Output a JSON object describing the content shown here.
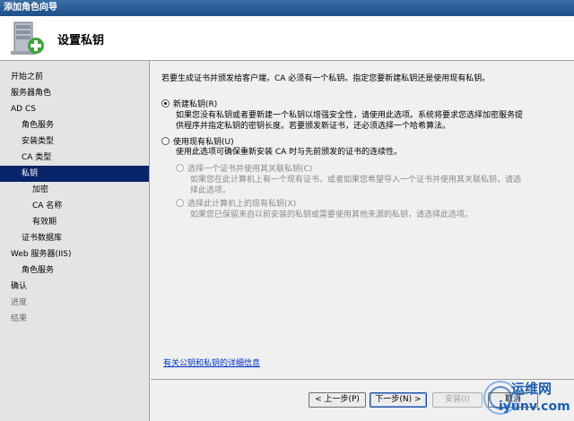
{
  "window": {
    "title": "添加角色向导"
  },
  "header": {
    "page_title": "设置私钥"
  },
  "sidebar": {
    "items": [
      {
        "label": "开始之前",
        "level": 0,
        "state": "normal"
      },
      {
        "label": "服务器角色",
        "level": 0,
        "state": "normal"
      },
      {
        "label": "AD CS",
        "level": 0,
        "state": "normal"
      },
      {
        "label": "角色服务",
        "level": 1,
        "state": "normal"
      },
      {
        "label": "安装类型",
        "level": 1,
        "state": "normal"
      },
      {
        "label": "CA 类型",
        "level": 1,
        "state": "normal"
      },
      {
        "label": "私钥",
        "level": 1,
        "state": "active"
      },
      {
        "label": "加密",
        "level": 2,
        "state": "normal"
      },
      {
        "label": "CA 名称",
        "level": 2,
        "state": "normal"
      },
      {
        "label": "有效期",
        "level": 2,
        "state": "normal"
      },
      {
        "label": "证书数据库",
        "level": 1,
        "state": "normal"
      },
      {
        "label": "Web 服务器(IIS)",
        "level": 0,
        "state": "normal"
      },
      {
        "label": "角色服务",
        "level": 1,
        "state": "normal"
      },
      {
        "label": "确认",
        "level": 0,
        "state": "normal"
      },
      {
        "label": "进度",
        "level": 0,
        "state": "disabled"
      },
      {
        "label": "结果",
        "level": 0,
        "state": "disabled"
      }
    ]
  },
  "content": {
    "intro": "若要生成证书并颁发给客户端，CA 必须有一个私钥。指定您要新建私钥还是使用现有私钥。",
    "new_key": {
      "label": "新建私钥(R)",
      "desc_line1": "如果您没有私钥或者要新建一个私钥以增强安全性，请使用此选项。系统将要求您选择加密服务提",
      "desc_line2": "供程序并指定私钥的密钥长度。若要颁发新证书，还必须选择一个哈希算法。"
    },
    "existing_key": {
      "label": "使用现有私钥(U)",
      "desc": "使用此选项可确保重新安装 CA 时与先前颁发的证书的连续性。"
    },
    "sub_cert": {
      "label": "选择一个证书并使用其关联私钥(C)",
      "desc_line1": "如果您在此计算机上有一个现有证书，或者如果您希望导入一个证书并使用其关联私钥，请选",
      "desc_line2": "择此选项。"
    },
    "sub_key": {
      "label": "选择此计算机上的现有私钥(X)",
      "desc": "如果您已保留来自以前安装的私钥或需要使用其他来源的私钥，请选择此选项。"
    },
    "help_link": "有关公钥和私钥的详细信息"
  },
  "footer": {
    "prev": "< 上一步(P)",
    "next": "下一步(N) >",
    "install": "安装(I)",
    "cancel": "取消"
  },
  "watermark": {
    "line1": "运维网",
    "line2": "iyunv.com"
  }
}
